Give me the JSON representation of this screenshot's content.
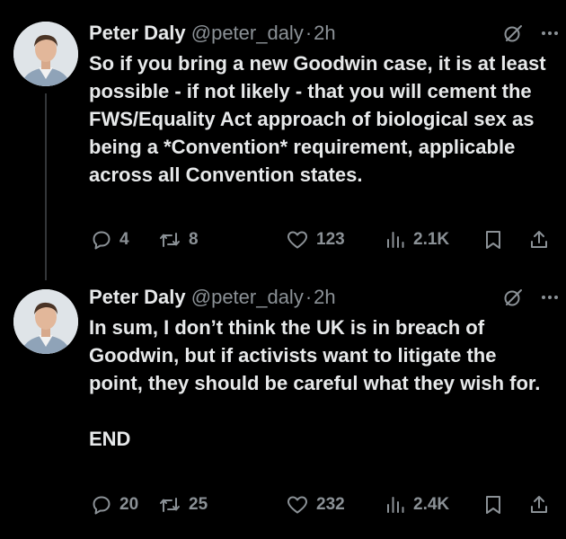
{
  "tweets": [
    {
      "author": {
        "name": "Peter Daly",
        "handle": "@peter_daly",
        "time": "2h"
      },
      "text": "So if you bring a new Goodwin case, it is at least possible - if not likely - that you will cement the FWS/Equality Act approach of biological sex as being a *Convention* requirement, applicable across all Convention states.",
      "stats": {
        "replies": "4",
        "retweets": "8",
        "likes": "123",
        "views": "2.1K"
      }
    },
    {
      "author": {
        "name": "Peter Daly",
        "handle": "@peter_daly",
        "time": "2h"
      },
      "text": "In sum, I don’t think the UK is in breach of Goodwin, but if activists want to litigate the point, they should be careful what they wish for.\n\nEND",
      "stats": {
        "replies": "20",
        "retweets": "25",
        "likes": "232",
        "views": "2.4K"
      }
    }
  ],
  "separator": "·",
  "icons": [
    "avatar",
    "grok-icon",
    "more-icon",
    "reply-icon",
    "retweet-icon",
    "like-icon",
    "views-icon",
    "bookmark-icon",
    "share-icon"
  ],
  "colors": {
    "background": "#000000",
    "text": "#e7e9ea",
    "secondary": "#8b9196",
    "thread_line": "#333639"
  }
}
